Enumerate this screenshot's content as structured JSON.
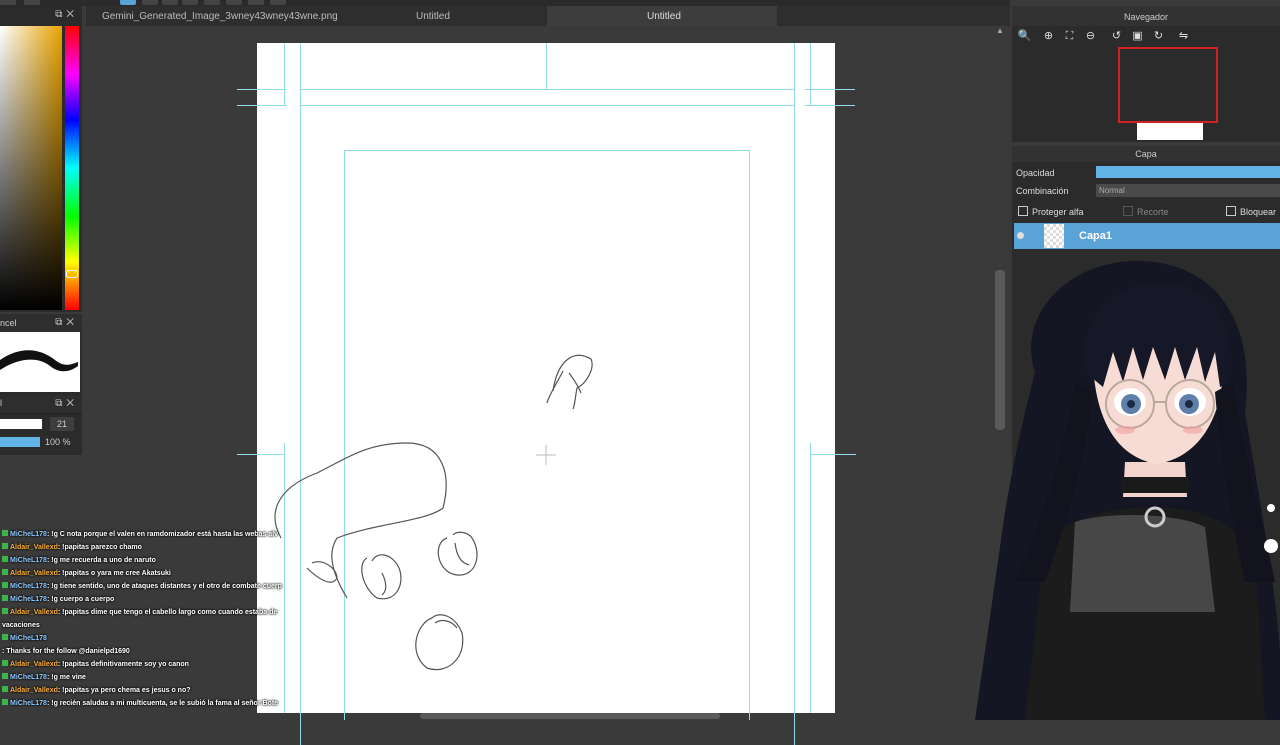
{
  "tabs": [
    {
      "label": "Gemini_Generated_Image_3wney43wney43wne.png"
    },
    {
      "label": "Untitled"
    },
    {
      "label": "Untitled"
    }
  ],
  "navigator": {
    "title": "Navegador",
    "buttons": [
      "zoom-out-icon",
      "zoom-in-icon",
      "fit-icon",
      "zoom-reset-icon",
      "rotate-left-icon",
      "fullscreen-icon",
      "rotate-right-icon",
      "flip-icon"
    ]
  },
  "layer_panel": {
    "title": "Capa",
    "opacity_label": "Opacidad",
    "opacity_value": 1.0,
    "blend_label": "Combinación",
    "blend_value": "Normal",
    "protect_alpha_label": "Proteger alfa",
    "clip_label": "Recorte",
    "lock_label": "Bloquear",
    "layers": [
      {
        "name": "Capa1",
        "visible": true,
        "selected": true
      }
    ]
  },
  "brush_panel": {
    "title_partial": "ncel"
  },
  "size_panel": {
    "size_value": "21",
    "opacity_value": "100 %"
  },
  "chat": [
    {
      "user": "MiCheL178",
      "msg": ": !g C nota porque el valen en ramdomizador está hasta las webas alv",
      "color": "u1"
    },
    {
      "user": "Aldair_Vallexd",
      "msg": ": !papitas parezco chamo",
      "color": "u2"
    },
    {
      "user": "MiCheL178",
      "msg": ": !g me recuerda a uno de naruto",
      "color": "u1"
    },
    {
      "user": "Aldair_Vallexd",
      "msg": ": !papitas o yara me cree Akatsuki",
      "color": "u2"
    },
    {
      "user": "MiCheL178",
      "msg": ": !g tiene sentido, uno de ataques distantes y el otro de combate cuerp",
      "color": "u1"
    },
    {
      "user": "MiCheL178",
      "msg": ": !g cuerpo a cuerpo",
      "color": "u1"
    },
    {
      "user": "Aldair_Vallexd",
      "msg": ": !papitas dime que tengo el cabello largo como cuando estaba de",
      "color": "u2"
    },
    {
      "user": "",
      "msg": "vacaciones",
      "color": "u2"
    },
    {
      "user": "MiCheL178",
      "msg": "",
      "color": "u1"
    },
    {
      "user": "",
      "msg": ": Thanks for the follow @danielpd1690",
      "color": "u3"
    },
    {
      "user": "Aldair_Vallexd",
      "msg": ": !papitas definitivamente soy yo canon",
      "color": "u2"
    },
    {
      "user": "MiCheL178",
      "msg": ": !g me vine",
      "color": "u1"
    },
    {
      "user": "Aldair_Vallexd",
      "msg": ": !papitas ya pero chema es jesus o no?",
      "color": "u2"
    },
    {
      "user": "MiCheL178",
      "msg": ": !g recién saludas a mi multicuenta, se le subió la fama al señor Bote",
      "color": "u1"
    }
  ],
  "colors": {
    "accent": "#5aa3d6",
    "opacity_bar": "#63b4e6",
    "guide": "#8fdde8",
    "nav_frame": "#d32020",
    "panel_bg": "#2b2b2b",
    "canvas_bg": "#3a3a3a"
  }
}
